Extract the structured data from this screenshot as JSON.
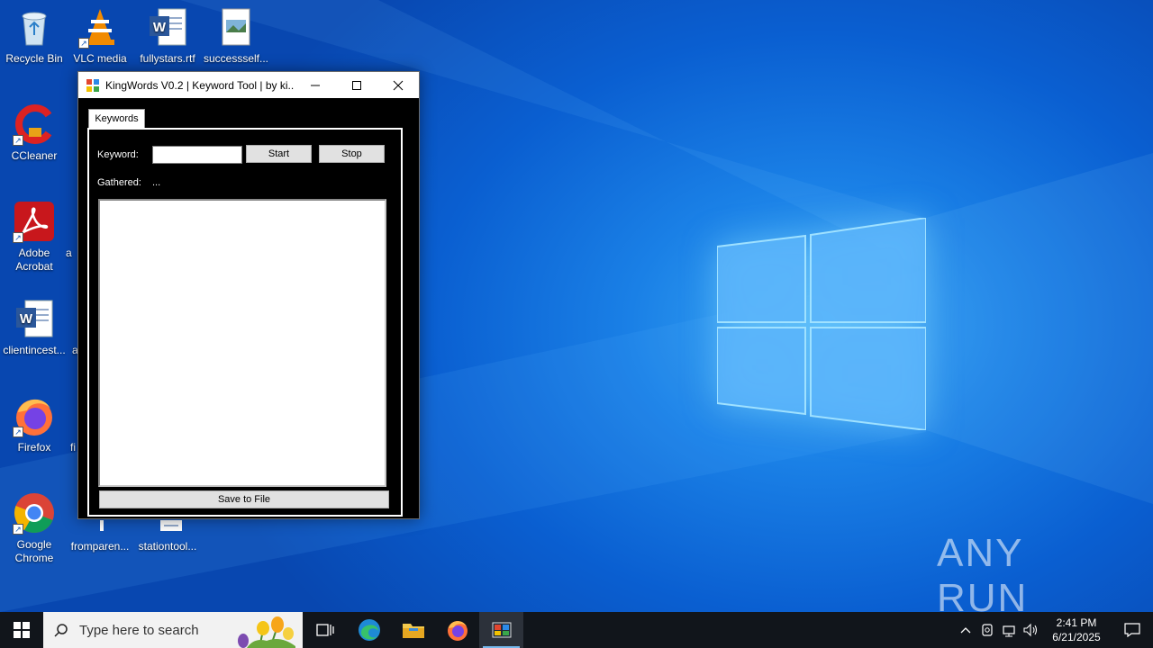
{
  "desktop": {
    "icons": [
      {
        "label": "Recycle Bin",
        "icon": "recycle-bin-icon"
      },
      {
        "label": "VLC media",
        "icon": "vlc-icon"
      },
      {
        "label": "fullystars.rtf",
        "icon": "word-doc-icon"
      },
      {
        "label": "successself...",
        "icon": "image-file-icon"
      },
      {
        "label": "CCleaner",
        "icon": "ccleaner-icon"
      },
      {
        "label": "Adobe Acrobat",
        "icon": "acrobat-icon"
      },
      {
        "label": "a",
        "icon": "partial-icon"
      },
      {
        "label": "clientincest...",
        "icon": "word-doc-icon"
      },
      {
        "label": "a",
        "icon": "partial-icon"
      },
      {
        "label": "Firefox",
        "icon": "firefox-icon"
      },
      {
        "label": "fi",
        "icon": "partial-icon"
      },
      {
        "label": "Google Chrome",
        "icon": "chrome-icon"
      },
      {
        "label": "fromparen...",
        "icon": "file-icon"
      },
      {
        "label": "stationtool...",
        "icon": "word-doc-icon"
      }
    ]
  },
  "window": {
    "title": "KingWords V0.2 | Keyword Tool | by ki...",
    "tab_label": "Keywords",
    "keyword_label": "Keyword:",
    "keyword_value": "",
    "start_label": "Start",
    "stop_label": "Stop",
    "gathered_label": "Gathered:",
    "gathered_value": "...",
    "save_label": "Save to File"
  },
  "watermark": {
    "text": "ANY RUN"
  },
  "taskbar": {
    "search_placeholder": "Type here to search",
    "pinned": [
      "task-view-icon",
      "edge-icon",
      "file-explorer-icon",
      "firefox-icon",
      "kingwords-app-icon"
    ],
    "clock_time": "2:41 PM",
    "clock_date": "6/21/2025"
  },
  "colors": {
    "desktop_blue": "#0a5fd1",
    "taskbar": "#11151b",
    "window_bg": "#000000"
  }
}
